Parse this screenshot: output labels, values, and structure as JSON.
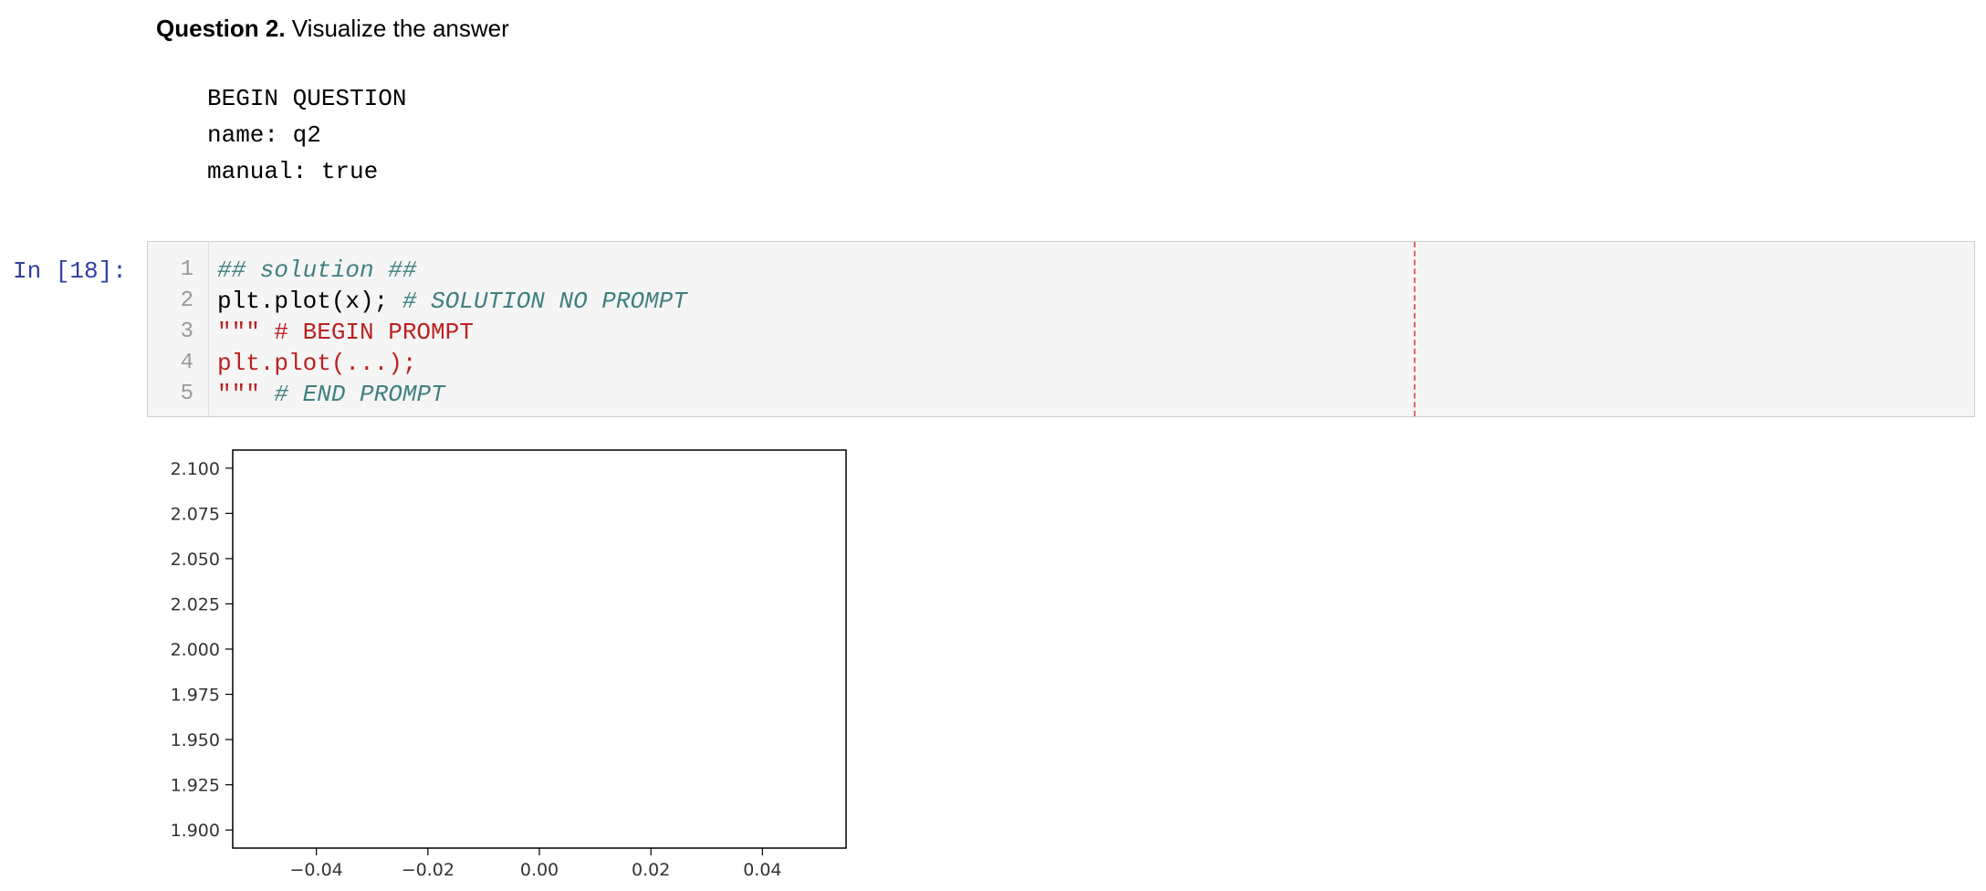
{
  "markdown_cell": {
    "heading_bold": "Question 2.",
    "heading_rest": " Visualize the answer",
    "meta_lines": [
      "BEGIN QUESTION",
      "name: q2",
      "manual: true"
    ]
  },
  "code_cell": {
    "prompt": "In [18]:",
    "line_numbers": [
      "1",
      "2",
      "3",
      "4",
      "5"
    ],
    "lines": [
      [
        {
          "t": "## solution ##",
          "c": "comment"
        }
      ],
      [
        {
          "t": "plt.plot(x); ",
          "c": "plain"
        },
        {
          "t": "# SOLUTION NO PROMPT",
          "c": "comment"
        }
      ],
      [
        {
          "t": "\"\"\" # BEGIN PROMPT",
          "c": "string"
        }
      ],
      [
        {
          "t": "plt.plot(...);",
          "c": "string"
        }
      ],
      [
        {
          "t": "\"\"\" ",
          "c": "string"
        },
        {
          "t": "# END PROMPT",
          "c": "comment"
        }
      ]
    ]
  },
  "chart_data": {
    "type": "line",
    "series": [],
    "x_ticks": [
      "−0.04",
      "−0.02",
      "0.00",
      "0.02",
      "0.04"
    ],
    "x_tick_values": [
      -0.04,
      -0.02,
      0.0,
      0.02,
      0.04
    ],
    "y_ticks": [
      "2.100",
      "2.075",
      "2.050",
      "2.025",
      "2.000",
      "1.975",
      "1.950",
      "1.925",
      "1.900"
    ],
    "y_tick_values": [
      2.1,
      2.075,
      2.05,
      2.025,
      2.0,
      1.975,
      1.95,
      1.925,
      1.9
    ],
    "xlim": [
      -0.055,
      0.055
    ],
    "ylim": [
      1.89,
      2.11
    ],
    "grid": false,
    "title": "",
    "xlabel": "",
    "ylabel": ""
  }
}
